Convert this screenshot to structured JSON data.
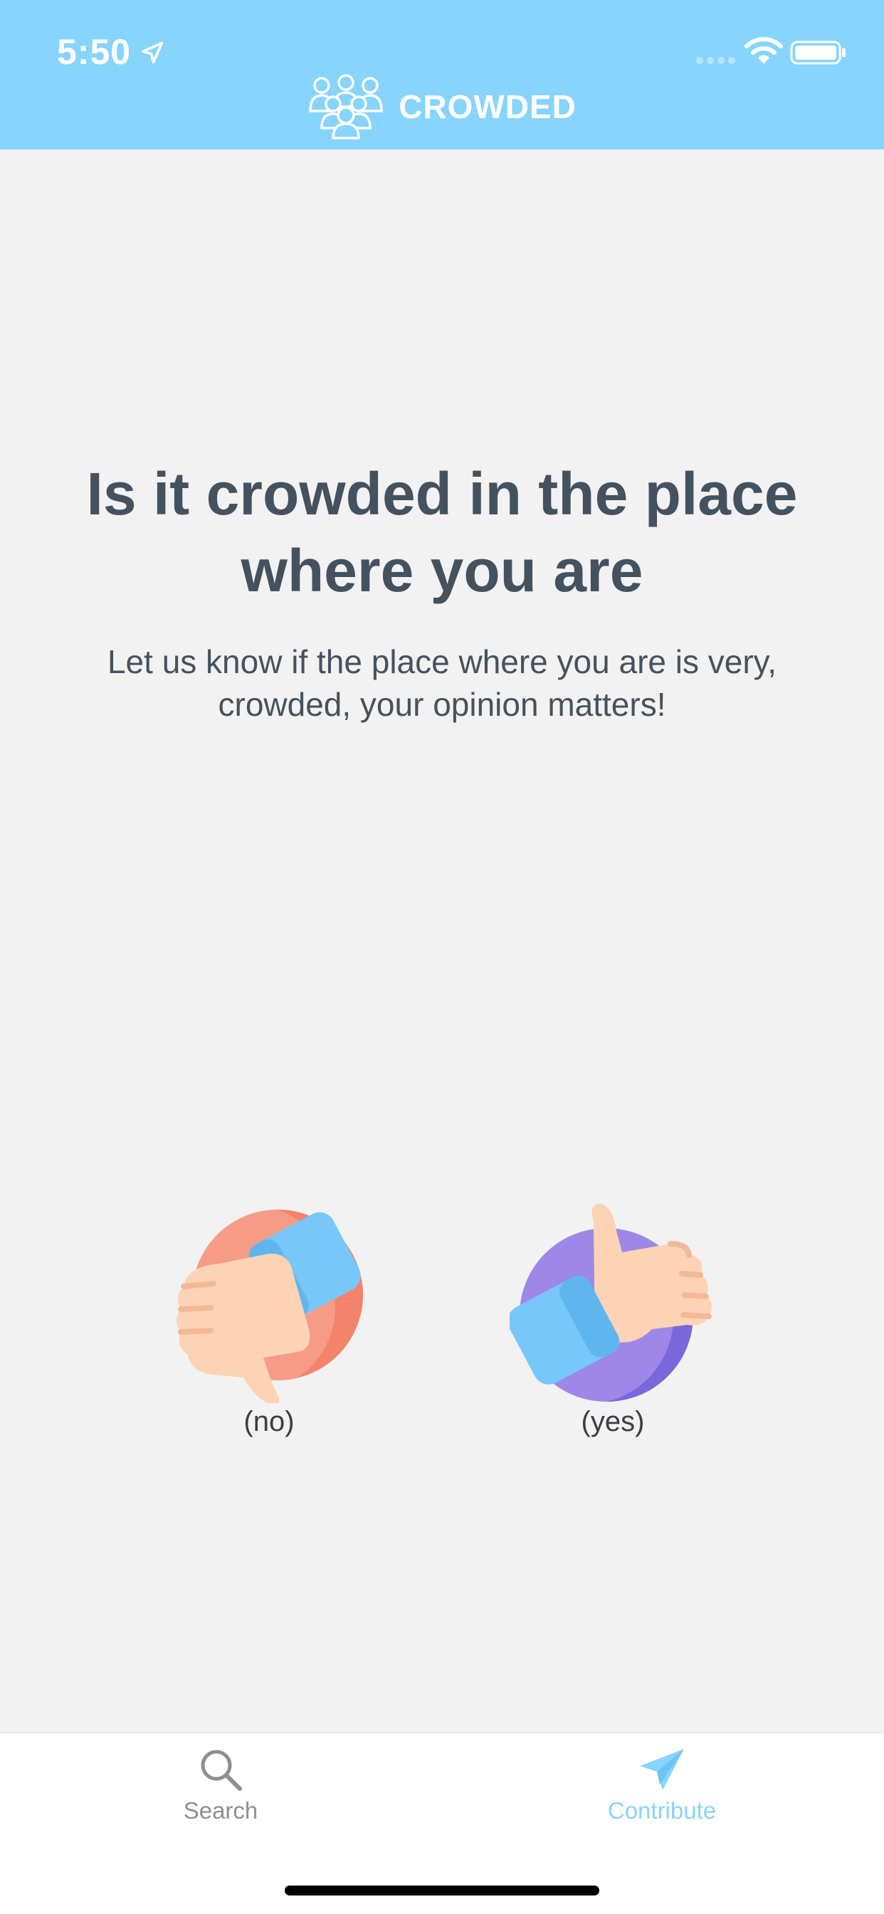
{
  "status_bar": {
    "time": "5:50"
  },
  "header": {
    "brand_name": "CROWDED"
  },
  "hero": {
    "title": "Is it crowded in the place where you are",
    "subtitle": "Let us know if the place where you are is very, crowded, your opinion matters!"
  },
  "choices": [
    {
      "label": "(no)",
      "icon": "thumbs-down-icon"
    },
    {
      "label": "(yes)",
      "icon": "thumbs-up-icon"
    }
  ],
  "tabbar": {
    "tabs": [
      {
        "label": "Search",
        "icon": "search-icon",
        "active": false
      },
      {
        "label": "Contribute",
        "icon": "paper-plane-icon",
        "active": true
      }
    ]
  },
  "colors": {
    "header": "#87d4fc",
    "background": "#f2f2f2",
    "title_text": "#44525f",
    "active_tab": "#87d4fc",
    "inactive_tab": "#8d8f91"
  }
}
